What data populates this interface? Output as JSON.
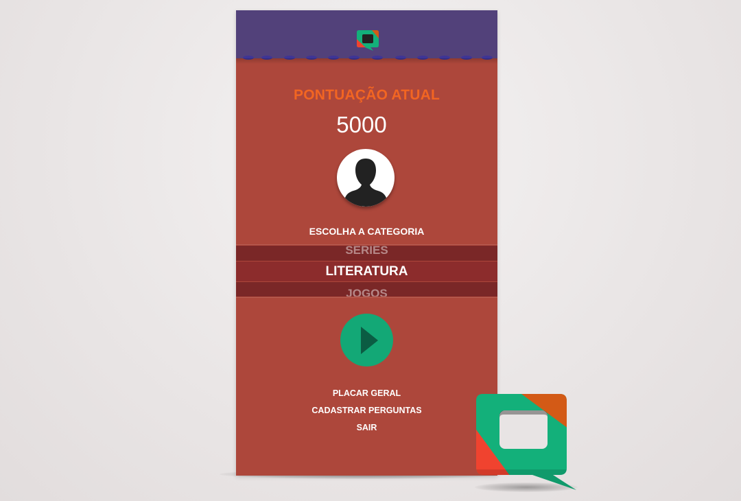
{
  "colors": {
    "background": "#ece8e8",
    "header": "#52417a",
    "screen": "#ad473b",
    "score_label": "#f26522",
    "picker_band": "#7a2727",
    "picker_selected": "#8c2c2c",
    "play_button": "#13a876",
    "logo_green": "#13b07a",
    "logo_red": "#f0432f",
    "logo_orange": "#d35a16"
  },
  "score": {
    "label": "PONTUAÇÃO ATUAL",
    "value": "5000"
  },
  "avatar": {
    "icon": "user-silhouette-icon"
  },
  "category": {
    "title": "ESCOLHA A CATEGORIA",
    "options": [
      "SERIES",
      "LITERATURA",
      "JOGOS"
    ],
    "selected": "LITERATURA"
  },
  "play": {
    "icon": "play-icon"
  },
  "menu": {
    "items": [
      "PLACAR GERAL",
      "CADASTRAR PERGUNTAS",
      "SAIR"
    ]
  },
  "branding": {
    "icon": "chat-bubble-logo-icon"
  }
}
